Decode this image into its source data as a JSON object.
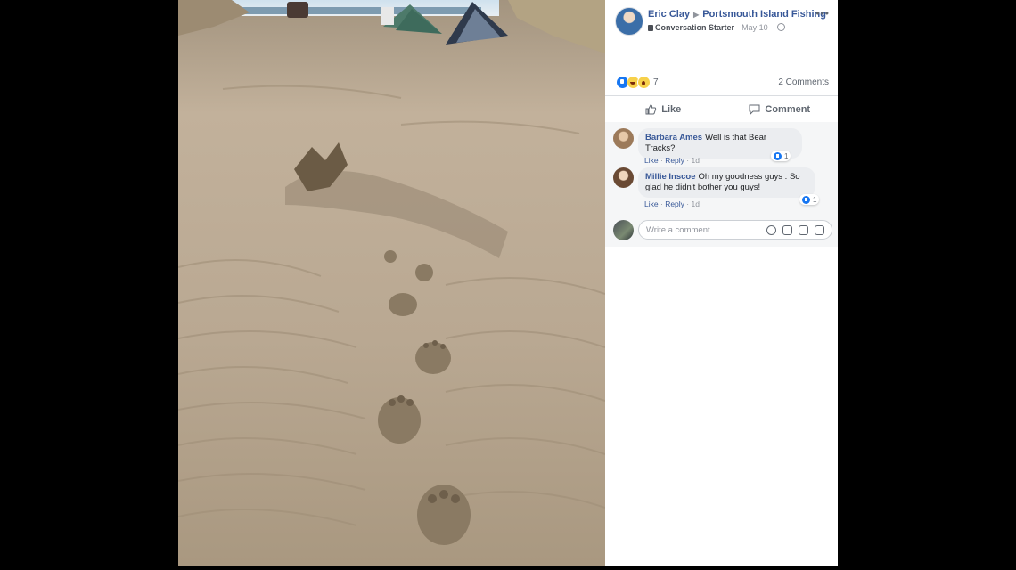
{
  "post": {
    "author": "Eric Clay",
    "group": "Portsmouth Island Fishing",
    "more": "•••",
    "badge": "Conversation Starter",
    "date": "May 10",
    "separator": "·"
  },
  "reactions": {
    "types": [
      "like",
      "haha",
      "wow"
    ],
    "count": "7",
    "comments_label": "2 Comments"
  },
  "actions": {
    "like_label": "Like",
    "comment_label": "Comment"
  },
  "comments": [
    {
      "name": "Barbara Ames",
      "text": "Well is that Bear Tracks?",
      "reaction_count": "1",
      "like": "Like",
      "reply": "Reply",
      "age": "1d",
      "sep": "·"
    },
    {
      "name": "Millie Inscoe",
      "text": "Oh my goodness guys . So glad he didn't bother you guys!",
      "reaction_count": "1",
      "like": "Like",
      "reply": "Reply",
      "age": "1d",
      "sep": "·"
    }
  ],
  "composer": {
    "placeholder": "Write a comment..."
  },
  "colors": {
    "link": "#385898",
    "like_blue": "#1877f2",
    "sand": "#b8a892",
    "backdrop": "#000000"
  }
}
